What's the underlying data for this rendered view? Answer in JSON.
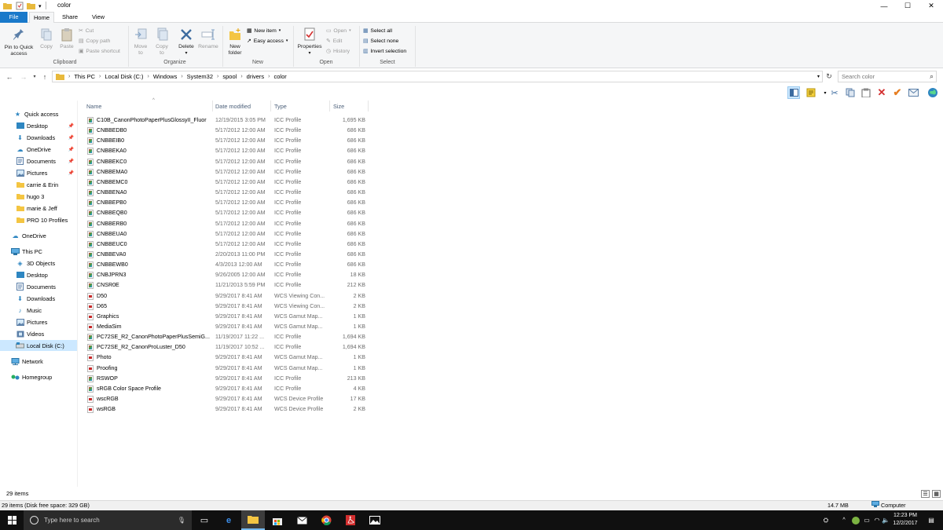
{
  "window": {
    "title": "color",
    "controls": {
      "minimize": "—",
      "maximize": "☐",
      "close": "✕"
    }
  },
  "ribbon": {
    "tabs": [
      "File",
      "Home",
      "Share",
      "View"
    ],
    "clipboard": {
      "pin": "Pin to Quick access",
      "copy": "Copy",
      "paste": "Paste",
      "cut": "Cut",
      "copy_path": "Copy path",
      "paste_shortcut": "Paste shortcut",
      "group": "Clipboard"
    },
    "organize": {
      "move_to": "Move to",
      "copy_to": "Copy to",
      "delete": "Delete",
      "rename": "Rename",
      "group": "Organize"
    },
    "new": {
      "new_folder": "New folder",
      "new_item": "New item",
      "easy_access": "Easy access",
      "group": "New"
    },
    "open": {
      "properties": "Properties",
      "open": "Open",
      "edit": "Edit",
      "history": "History",
      "group": "Open"
    },
    "select": {
      "select_all": "Select all",
      "select_none": "Select none",
      "invert": "Invert selection",
      "group": "Select"
    }
  },
  "address": {
    "crumbs": [
      "This PC",
      "Local Disk (C:)",
      "Windows",
      "System32",
      "spool",
      "drivers",
      "color"
    ],
    "search_placeholder": "Search color"
  },
  "nav": {
    "quick_access": "Quick access",
    "qa_items": [
      "Desktop",
      "Downloads",
      "OneDrive",
      "Documents",
      "Pictures",
      "carrie & Erin",
      "hugo 3",
      "marie & Jeff",
      "PRO 10 Profiles"
    ],
    "onedrive": "OneDrive",
    "this_pc": "This PC",
    "pc_items": [
      "3D Objects",
      "Desktop",
      "Documents",
      "Downloads",
      "Music",
      "Pictures",
      "Videos",
      "Local Disk (C:)"
    ],
    "network": "Network",
    "homegroup": "Homegroup"
  },
  "columns": {
    "name": "Name",
    "date": "Date modified",
    "type": "Type",
    "size": "Size"
  },
  "files": [
    {
      "name": "C10B_CanonPhotoPaperPlusGlossyII_Fluor",
      "date": "12/19/2015 3:05 PM",
      "type": "ICC Profile",
      "size": "1,695 KB",
      "icon": "icc"
    },
    {
      "name": "CNBBEDB0",
      "date": "5/17/2012 12:00 AM",
      "type": "ICC Profile",
      "size": "686 KB",
      "icon": "icc"
    },
    {
      "name": "CNBBEIB0",
      "date": "5/17/2012 12:00 AM",
      "type": "ICC Profile",
      "size": "686 KB",
      "icon": "icc"
    },
    {
      "name": "CNBBEKA0",
      "date": "5/17/2012 12:00 AM",
      "type": "ICC Profile",
      "size": "686 KB",
      "icon": "icc"
    },
    {
      "name": "CNBBEKC0",
      "date": "5/17/2012 12:00 AM",
      "type": "ICC Profile",
      "size": "686 KB",
      "icon": "icc"
    },
    {
      "name": "CNBBEMA0",
      "date": "5/17/2012 12:00 AM",
      "type": "ICC Profile",
      "size": "686 KB",
      "icon": "icc"
    },
    {
      "name": "CNBBEMC0",
      "date": "5/17/2012 12:00 AM",
      "type": "ICC Profile",
      "size": "686 KB",
      "icon": "icc"
    },
    {
      "name": "CNBBENA0",
      "date": "5/17/2012 12:00 AM",
      "type": "ICC Profile",
      "size": "686 KB",
      "icon": "icc"
    },
    {
      "name": "CNBBEPB0",
      "date": "5/17/2012 12:00 AM",
      "type": "ICC Profile",
      "size": "686 KB",
      "icon": "icc"
    },
    {
      "name": "CNBBEQB0",
      "date": "5/17/2012 12:00 AM",
      "type": "ICC Profile",
      "size": "686 KB",
      "icon": "icc"
    },
    {
      "name": "CNBBERB0",
      "date": "5/17/2012 12:00 AM",
      "type": "ICC Profile",
      "size": "686 KB",
      "icon": "icc"
    },
    {
      "name": "CNBBEUA0",
      "date": "5/17/2012 12:00 AM",
      "type": "ICC Profile",
      "size": "686 KB",
      "icon": "icc"
    },
    {
      "name": "CNBBEUC0",
      "date": "5/17/2012 12:00 AM",
      "type": "ICC Profile",
      "size": "686 KB",
      "icon": "icc"
    },
    {
      "name": "CNBBEVA0",
      "date": "2/20/2013 11:00 PM",
      "type": "ICC Profile",
      "size": "686 KB",
      "icon": "icc"
    },
    {
      "name": "CNBBEWB0",
      "date": "4/3/2013 12:00 AM",
      "type": "ICC Profile",
      "size": "686 KB",
      "icon": "icc"
    },
    {
      "name": "CNBJPRN3",
      "date": "9/26/2005 12:00 AM",
      "type": "ICC Profile",
      "size": "18 KB",
      "icon": "icc"
    },
    {
      "name": "CNSR0E",
      "date": "11/21/2013 5:59 PM",
      "type": "ICC Profile",
      "size": "212 KB",
      "icon": "icc"
    },
    {
      "name": "D50",
      "date": "9/29/2017 8:41 AM",
      "type": "WCS Viewing Con...",
      "size": "2 KB",
      "icon": "wcs"
    },
    {
      "name": "D65",
      "date": "9/29/2017 8:41 AM",
      "type": "WCS Viewing Con...",
      "size": "2 KB",
      "icon": "wcs"
    },
    {
      "name": "Graphics",
      "date": "9/29/2017 8:41 AM",
      "type": "WCS Gamut Map...",
      "size": "1 KB",
      "icon": "wcs"
    },
    {
      "name": "MediaSim",
      "date": "9/29/2017 8:41 AM",
      "type": "WCS Gamut Map...",
      "size": "1 KB",
      "icon": "wcs"
    },
    {
      "name": "PC72SE_R2_CanonPhotoPaperPlusSemiG...",
      "date": "11/19/2017 11:22 ...",
      "type": "ICC Profile",
      "size": "1,694 KB",
      "icon": "icc"
    },
    {
      "name": "PC72SE_R2_CanonProLuster_D50",
      "date": "11/19/2017 10:52 ...",
      "type": "ICC Profile",
      "size": "1,694 KB",
      "icon": "icc"
    },
    {
      "name": "Photo",
      "date": "9/29/2017 8:41 AM",
      "type": "WCS Gamut Map...",
      "size": "1 KB",
      "icon": "wcs"
    },
    {
      "name": "Proofing",
      "date": "9/29/2017 8:41 AM",
      "type": "WCS Gamut Map...",
      "size": "1 KB",
      "icon": "wcs"
    },
    {
      "name": "RSWOP",
      "date": "9/29/2017 8:41 AM",
      "type": "ICC Profile",
      "size": "213 KB",
      "icon": "icc"
    },
    {
      "name": "sRGB Color Space Profile",
      "date": "9/29/2017 8:41 AM",
      "type": "ICC Profile",
      "size": "4 KB",
      "icon": "icc"
    },
    {
      "name": "wscRGB",
      "date": "9/29/2017 8:41 AM",
      "type": "WCS Device Profile",
      "size": "17 KB",
      "icon": "wcs"
    },
    {
      "name": "wsRGB",
      "date": "9/29/2017 8:41 AM",
      "type": "WCS Device Profile",
      "size": "2 KB",
      "icon": "wcs"
    }
  ],
  "status": {
    "item_count": "29 items",
    "details": "29 items (Disk free space: 329 GB)",
    "size": "14.7 MB",
    "location": "Computer"
  },
  "taskbar": {
    "search_placeholder": "Type here to search",
    "time": "12:23 PM",
    "date": "12/2/2017"
  },
  "colors": {
    "accent": "#1979ca",
    "selected": "#cce8ff",
    "taskbar": "#101010"
  }
}
